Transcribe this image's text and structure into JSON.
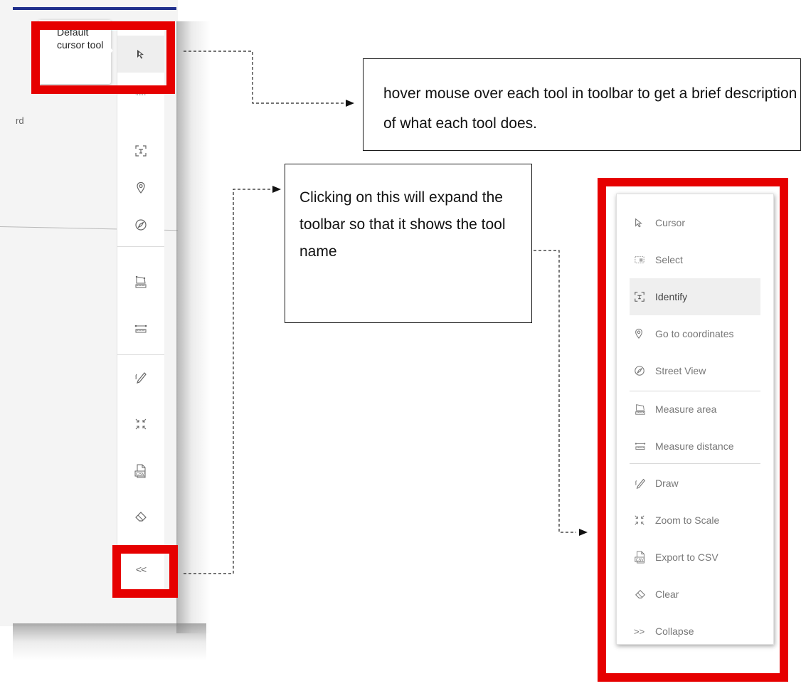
{
  "left_panel": {
    "map_partial_text": "rd",
    "tooltip_text": "Default cursor tool",
    "collapse_glyph": "<<",
    "tools": [
      {
        "icon": "cursor-icon"
      },
      {
        "icon": "select-icon"
      },
      {
        "icon": "identify-icon"
      },
      {
        "icon": "location-pin-icon"
      },
      {
        "icon": "compass-icon"
      },
      {
        "icon": "measure-area-icon"
      },
      {
        "icon": "measure-distance-icon"
      },
      {
        "icon": "draw-icon"
      },
      {
        "icon": "zoom-to-scale-icon"
      },
      {
        "icon": "export-csv-icon"
      },
      {
        "icon": "clear-eraser-icon"
      }
    ]
  },
  "callouts": {
    "hover_text": " hover mouse over each tool in toolbar to get a brief description of what each tool does.",
    "expand_text": "Clicking on this will expand the toolbar so that it shows the tool name"
  },
  "expanded_panel": {
    "items": [
      {
        "label": "Cursor",
        "icon": "cursor-icon"
      },
      {
        "label": "Select",
        "icon": "select-icon"
      },
      {
        "label": "Identify",
        "icon": "identify-icon"
      },
      {
        "label": "Go to coordinates",
        "icon": "location-pin-icon"
      },
      {
        "label": "Street View",
        "icon": "compass-icon"
      },
      {
        "label": "Measure area",
        "icon": "measure-area-icon"
      },
      {
        "label": "Measure distance",
        "icon": "measure-distance-icon"
      },
      {
        "label": "Draw",
        "icon": "draw-icon"
      },
      {
        "label": "Zoom to Scale",
        "icon": "zoom-to-scale-icon"
      },
      {
        "label": "Export to CSV",
        "icon": "export-csv-icon"
      },
      {
        "label": "Clear",
        "icon": "clear-eraser-icon"
      },
      {
        "label": "Collapse",
        "icon": "expand-chevrons-icon",
        "glyph": ">>"
      }
    ]
  },
  "colors": {
    "highlight_red": "#e60000",
    "accent_blue": "#1f2f8c",
    "icon_gray": "#6e6e6e"
  }
}
